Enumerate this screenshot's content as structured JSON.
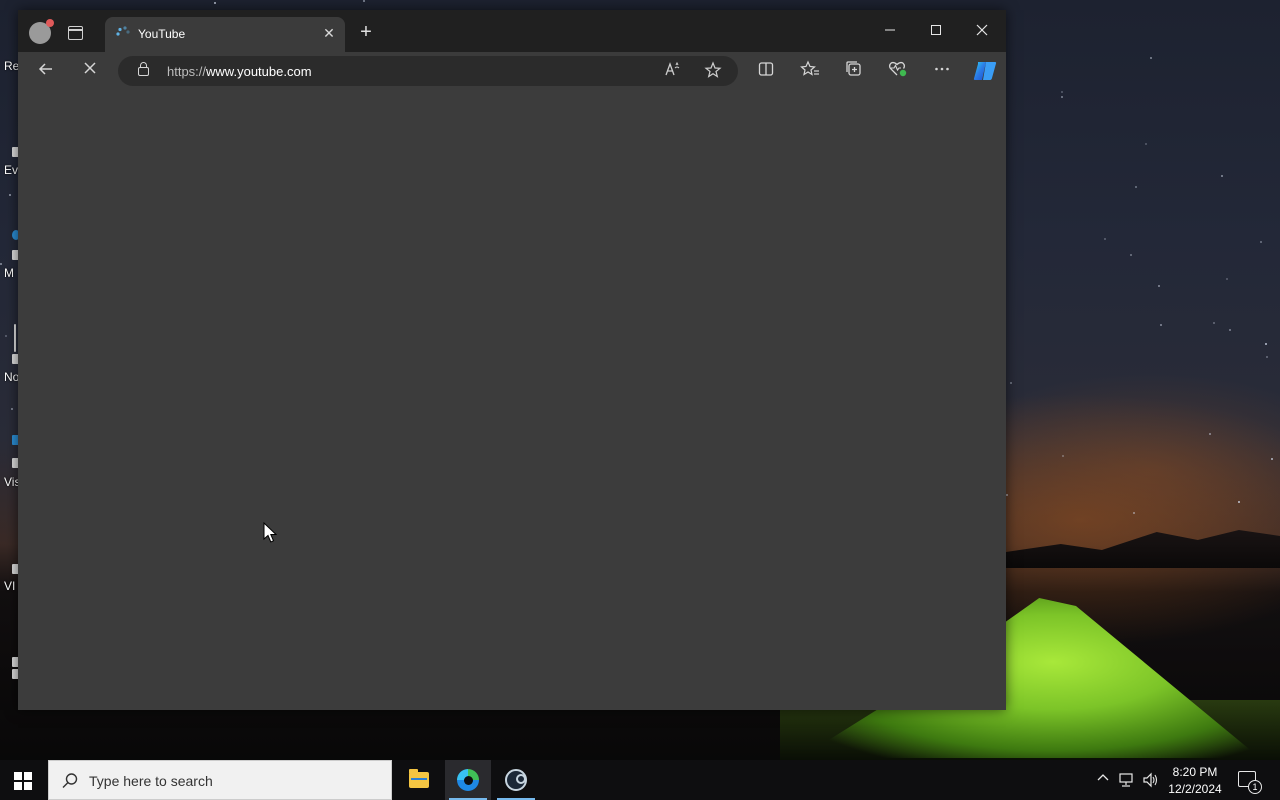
{
  "desktop": {
    "icons": [
      {
        "label": "Re",
        "icon": "recycle-bin-icon"
      },
      {
        "label": "Ev",
        "icon": "app-shortcut-icon"
      },
      {
        "label": "M",
        "icon": "edge-shortcut-icon"
      },
      {
        "label": "No",
        "icon": "notepad-shortcut-icon"
      },
      {
        "label": "Vis",
        "icon": "visual-studio-icon"
      },
      {
        "label": "VI",
        "icon": "vlc-shortcut-icon"
      },
      {
        "label": "",
        "icon": "steam-shortcut-icon"
      }
    ]
  },
  "browser": {
    "tab": {
      "title": "YouTube",
      "favicon": "loading-spinner-icon"
    },
    "address": {
      "scheme": "https://",
      "host": "www.youtube.com"
    },
    "icons": {
      "back": "←",
      "stop": "✕",
      "read_aloud": "A⁾",
      "favorite": "☆",
      "split_screen": "◫",
      "favorites": "✩",
      "collections": "⧉",
      "performance": "♡",
      "more": "···",
      "copilot": "copilot-icon"
    },
    "window_controls": {
      "minimize": "—",
      "maximize": "☐",
      "close": "✕"
    },
    "new_tab": "+"
  },
  "taskbar": {
    "search_placeholder": "Type here to search",
    "apps": [
      "file-explorer",
      "microsoft-edge",
      "steam"
    ],
    "active_app": "microsoft-edge",
    "clock": {
      "time": "8:20 PM",
      "date": "12/2/2024"
    },
    "notification_count": "1",
    "tray": {
      "chevron": "^",
      "network": "⊡",
      "volume": "🔊"
    }
  },
  "colors": {
    "titlebar": "#202020",
    "page_bg": "#3c3c3c",
    "taskbar": "#0e0e10",
    "accent": "#76b9ed"
  }
}
